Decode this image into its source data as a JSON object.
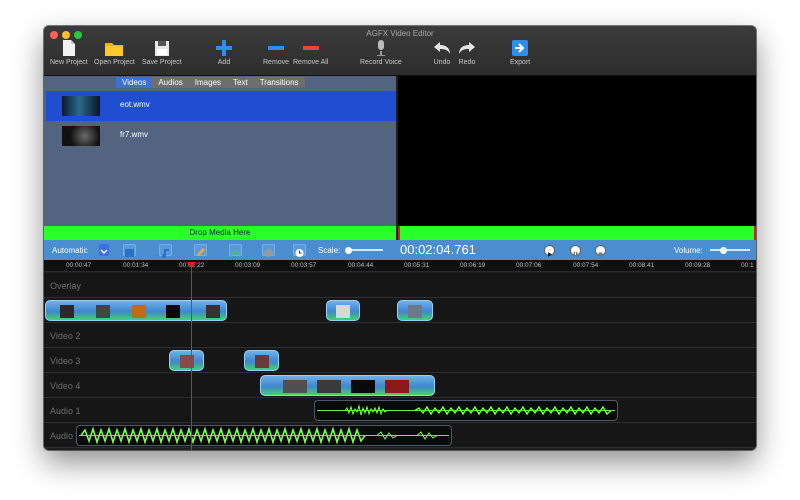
{
  "window": {
    "title": "AGFX Video Editor"
  },
  "toolbar": {
    "new_project": "New Project",
    "open_project": "Open Project",
    "save_project": "Save Project",
    "add": "Add",
    "remove": "Remove",
    "remove_all": "Remove All",
    "record_voice": "Record Voice",
    "undo": "Undo",
    "redo": "Redo",
    "export": "Export"
  },
  "media": {
    "tabs": [
      "Videos",
      "Audios",
      "Images",
      "Text",
      "Transitions"
    ],
    "active_tab": "Videos",
    "items": [
      {
        "name": "eot.wmv",
        "selected": true
      },
      {
        "name": "fr7.wmv",
        "selected": false
      }
    ],
    "drop_label": "Drop Media Here"
  },
  "controls": {
    "mode": "Automatic",
    "scale_label": "Scale:",
    "timecode": "00:02:04.761",
    "volume_label": "Volume:"
  },
  "ruler": {
    "labels": [
      "00:00:47",
      "00:01:34",
      "00:02:22",
      "00:03:09",
      "00:03:57",
      "00:04:44",
      "00:05:31",
      "00:06:19",
      "00:07:06",
      "00:07:54",
      "00:08:41",
      "00:09:28",
      "00:1"
    ]
  },
  "tracks": [
    "Overlay",
    "",
    "Video 2",
    "Video 3",
    "Video 4",
    "Audio 1",
    "Audio"
  ],
  "colors": {
    "accent_green": "#2bff2b",
    "control_bar": "#4a8ed0",
    "selection_blue": "#1f4fd0",
    "playhead": "#e02020"
  }
}
